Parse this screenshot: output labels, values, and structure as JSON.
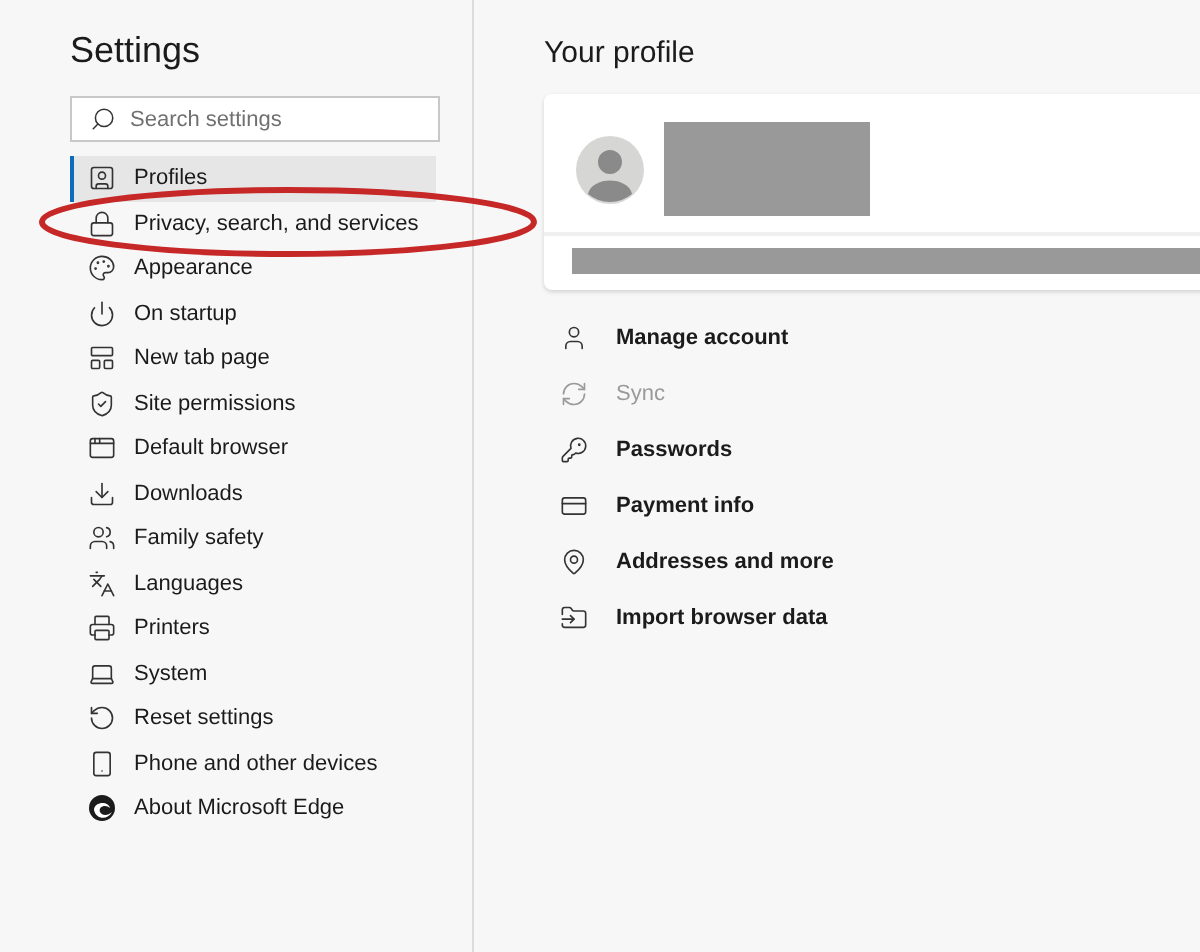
{
  "sidebar": {
    "title": "Settings",
    "search": {
      "placeholder": "Search settings"
    },
    "items": [
      {
        "label": "Profiles",
        "selected": true
      },
      {
        "label": "Privacy, search, and services",
        "selected": false
      },
      {
        "label": "Appearance",
        "selected": false
      },
      {
        "label": "On startup",
        "selected": false
      },
      {
        "label": "New tab page",
        "selected": false
      },
      {
        "label": "Site permissions",
        "selected": false
      },
      {
        "label": "Default browser",
        "selected": false
      },
      {
        "label": "Downloads",
        "selected": false
      },
      {
        "label": "Family safety",
        "selected": false
      },
      {
        "label": "Languages",
        "selected": false
      },
      {
        "label": "Printers",
        "selected": false
      },
      {
        "label": "System",
        "selected": false
      },
      {
        "label": "Reset settings",
        "selected": false
      },
      {
        "label": "Phone and other devices",
        "selected": false
      },
      {
        "label": "About Microsoft Edge",
        "selected": false
      }
    ]
  },
  "main": {
    "title": "Your profile",
    "profile_items": [
      {
        "label": "Manage account",
        "disabled": false
      },
      {
        "label": "Sync",
        "disabled": true
      },
      {
        "label": "Passwords",
        "disabled": false
      },
      {
        "label": "Payment info",
        "disabled": false
      },
      {
        "label": "Addresses and more",
        "disabled": false
      },
      {
        "label": "Import browser data",
        "disabled": false
      }
    ]
  }
}
